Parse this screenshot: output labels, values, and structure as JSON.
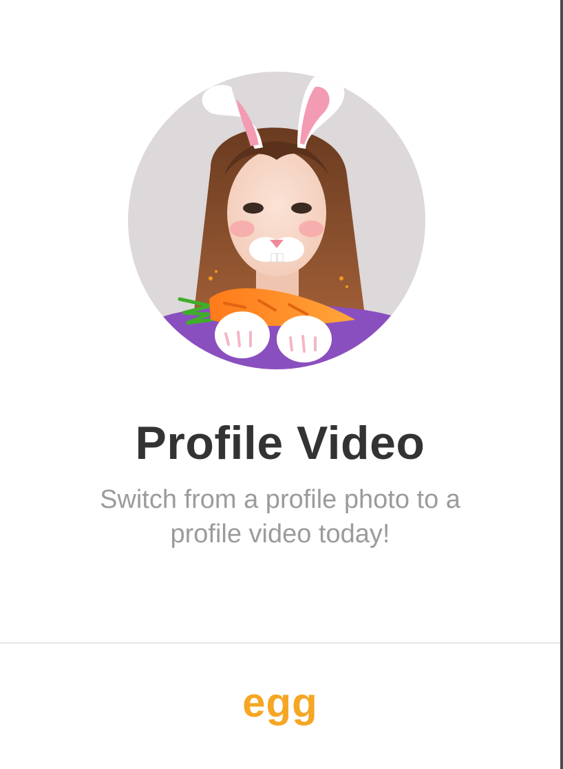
{
  "promo": {
    "title": "Profile Video",
    "description": "Switch from a profile photo to a profile video today!"
  },
  "brand": {
    "name": "egg",
    "color": "#f5a623"
  },
  "avatar": {
    "icon": "profile-avatar-bunny-filter"
  }
}
